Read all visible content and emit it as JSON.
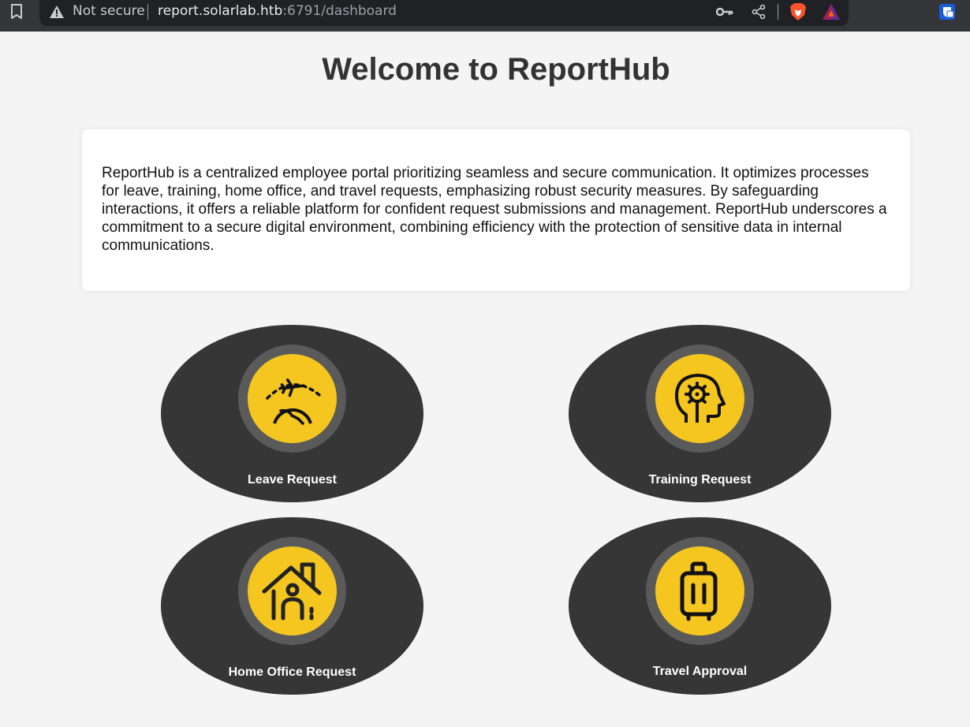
{
  "browser": {
    "security_label": "Not secure",
    "url_host": "report.solarlab.htb",
    "url_rest": ":6791/dashboard",
    "icons": [
      "bookmark-icon",
      "warning-icon",
      "key-icon",
      "share-icon",
      "brave-shield-icon",
      "brave-rewards-icon",
      "extension-icon"
    ],
    "colors": {
      "toolbar": "#35363a",
      "omnibox": "#202124"
    }
  },
  "page": {
    "title": "Welcome to ReportHub",
    "intro": "ReportHub is a centralized employee portal prioritizing seamless and secure communication. It optimizes processes for leave, training, home office, and travel requests, emphasizing robust security measures. By safeguarding interactions, it offers a reliable platform for confident request submissions and management. ReportHub underscores a commitment to a secure digital environment, combining efficiency with the protection of sensitive data in internal communications."
  },
  "tiles": [
    {
      "label": "Leave Request",
      "icon": "airplane-globe-icon"
    },
    {
      "label": "Training Request",
      "icon": "head-gear-icon"
    },
    {
      "label": "Home Office Request",
      "icon": "house-person-icon"
    },
    {
      "label": "Travel Approval",
      "icon": "suitcase-icon"
    }
  ],
  "colors": {
    "background": "#f4f4f4",
    "tile": "#363636",
    "ring": "#5a5a5a",
    "accent": "#f4c61f",
    "title": "#333333"
  }
}
